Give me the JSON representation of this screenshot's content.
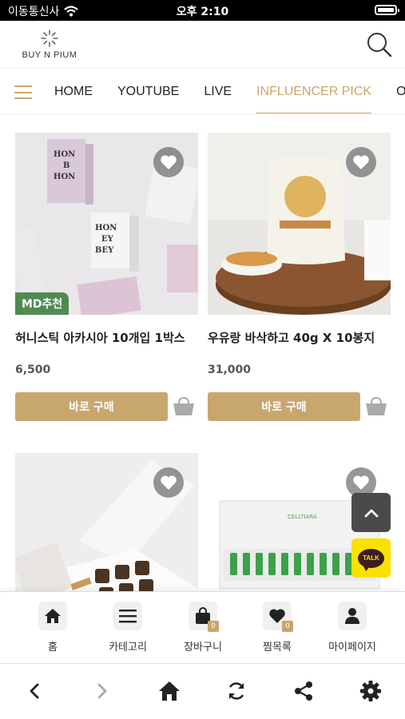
{
  "status_bar": {
    "carrier": "이동통신사",
    "time": "오후 2:10"
  },
  "header": {
    "logo_text": "BUY N PIUM"
  },
  "nav": {
    "items": [
      {
        "label": "HOME",
        "active": false
      },
      {
        "label": "YOUTUBE",
        "active": false
      },
      {
        "label": "LIVE",
        "active": false
      },
      {
        "label": "INFLUENCER PICK",
        "active": true
      },
      {
        "label": "ONLY",
        "active": false
      }
    ]
  },
  "products": [
    {
      "name": "허니스틱 아카시아 10개입 1박스",
      "price": "6,500",
      "badge": "MD추천",
      "buy_label": "바로 구매",
      "image_icon": "honey-stick-boxes"
    },
    {
      "name": "우유랑 바삭하고 40g X 10봉지",
      "price": "31,000",
      "buy_label": "바로 구매",
      "image_icon": "cereal-pouch"
    },
    {
      "name": "",
      "price": "",
      "image_icon": "gift-box-jars"
    },
    {
      "name": "",
      "price": "",
      "image_icon": "ampoule-set",
      "image_text": "CELLTIARA"
    }
  ],
  "floating": {
    "talk_label": "TALK"
  },
  "tab_bar": {
    "items": [
      {
        "label": "홈",
        "icon": "home-icon"
      },
      {
        "label": "카테고리",
        "icon": "menu-icon"
      },
      {
        "label": "장바구니",
        "icon": "shopping-bag-icon",
        "count": "0"
      },
      {
        "label": "찜목록",
        "icon": "heart-icon",
        "count": "0"
      },
      {
        "label": "마이페이지",
        "icon": "person-icon"
      }
    ]
  },
  "colors": {
    "accent": "#c9a56c",
    "buy_button": "#c8a76f",
    "badge": "#4f8a53",
    "kakao": "#fae100"
  }
}
